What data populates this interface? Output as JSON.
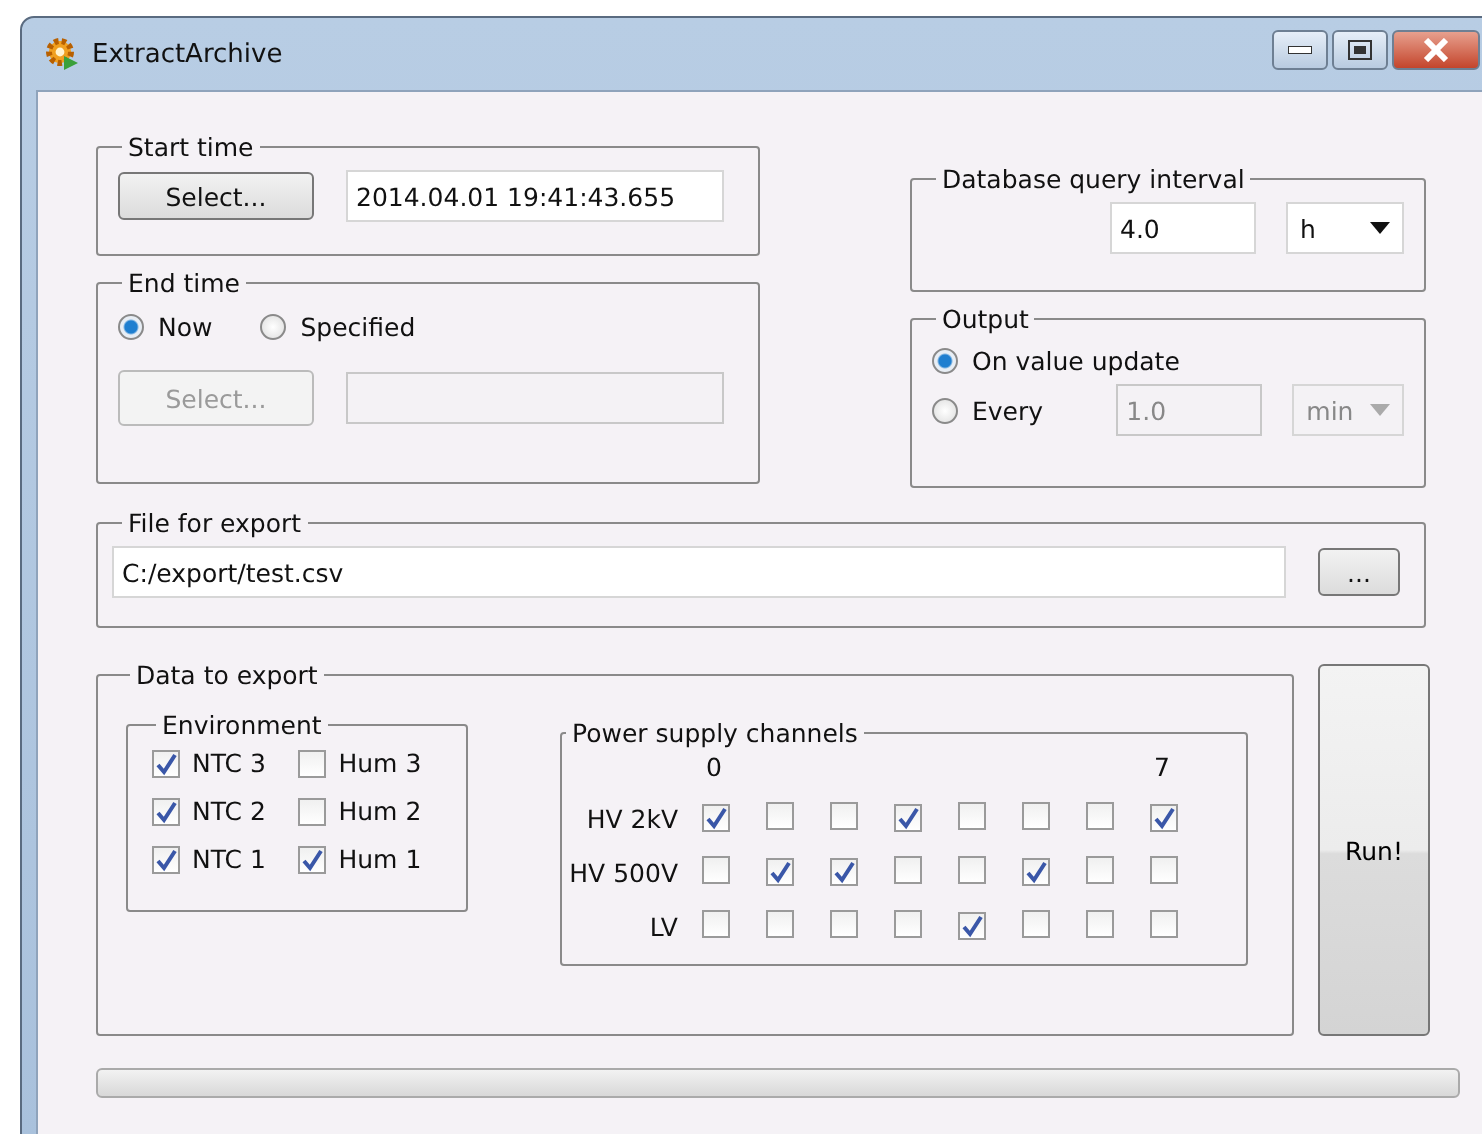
{
  "window": {
    "title": "ExtractArchive"
  },
  "start_time": {
    "title": "Start time",
    "button": {
      "label": "Select...",
      "disabled": false
    },
    "value": "2014.04.01 19:41:43.655"
  },
  "end_time": {
    "title": "End time",
    "options": [
      {
        "label": "Now",
        "selected": true
      },
      {
        "label": "Specified",
        "selected": false
      }
    ],
    "button": {
      "label": "Select...",
      "disabled": true
    },
    "field": {
      "disabled": true
    }
  },
  "query_interval": {
    "title": "Database query interval",
    "value": "4.0",
    "unit": "h"
  },
  "output": {
    "title": "Output",
    "options": [
      {
        "label": "On value update",
        "selected": true
      },
      {
        "label": "Every",
        "selected": false
      }
    ],
    "every_value": "1.0",
    "every_unit": "min",
    "every_disabled": true
  },
  "file_export": {
    "title": "File for export",
    "path": "C:/export/test.csv",
    "browse_button": "..."
  },
  "data_to_export": {
    "title": "Data to export",
    "environment": {
      "title": "Environment",
      "items": [
        {
          "label": "NTC 3",
          "checked": true
        },
        {
          "label": "Hum 3",
          "checked": false
        },
        {
          "label": "NTC 2",
          "checked": true
        },
        {
          "label": "Hum 2",
          "checked": false
        },
        {
          "label": "NTC 1",
          "checked": true
        },
        {
          "label": "Hum 1",
          "checked": true
        }
      ]
    },
    "power_supply": {
      "title": "Power supply channels",
      "channel_labels": [
        "0",
        "7"
      ],
      "rows": [
        {
          "label": "HV 2kV",
          "channels": [
            {
              "checked": true
            },
            {
              "checked": false
            },
            {
              "checked": false
            },
            {
              "checked": true
            },
            {
              "checked": false
            },
            {
              "checked": false
            },
            {
              "checked": false
            },
            {
              "checked": true
            }
          ]
        },
        {
          "label": "HV 500V",
          "channels": [
            {
              "checked": false
            },
            {
              "checked": true
            },
            {
              "checked": true
            },
            {
              "checked": false
            },
            {
              "checked": false
            },
            {
              "checked": true
            },
            {
              "checked": false
            },
            {
              "checked": false
            }
          ]
        },
        {
          "label": "LV",
          "channels": [
            {
              "checked": false
            },
            {
              "checked": false
            },
            {
              "checked": false
            },
            {
              "checked": false
            },
            {
              "checked": true
            },
            {
              "checked": false
            },
            {
              "checked": false
            },
            {
              "checked": false
            }
          ]
        }
      ]
    }
  },
  "run_button": "Run!",
  "progress": {
    "level": 0
  }
}
